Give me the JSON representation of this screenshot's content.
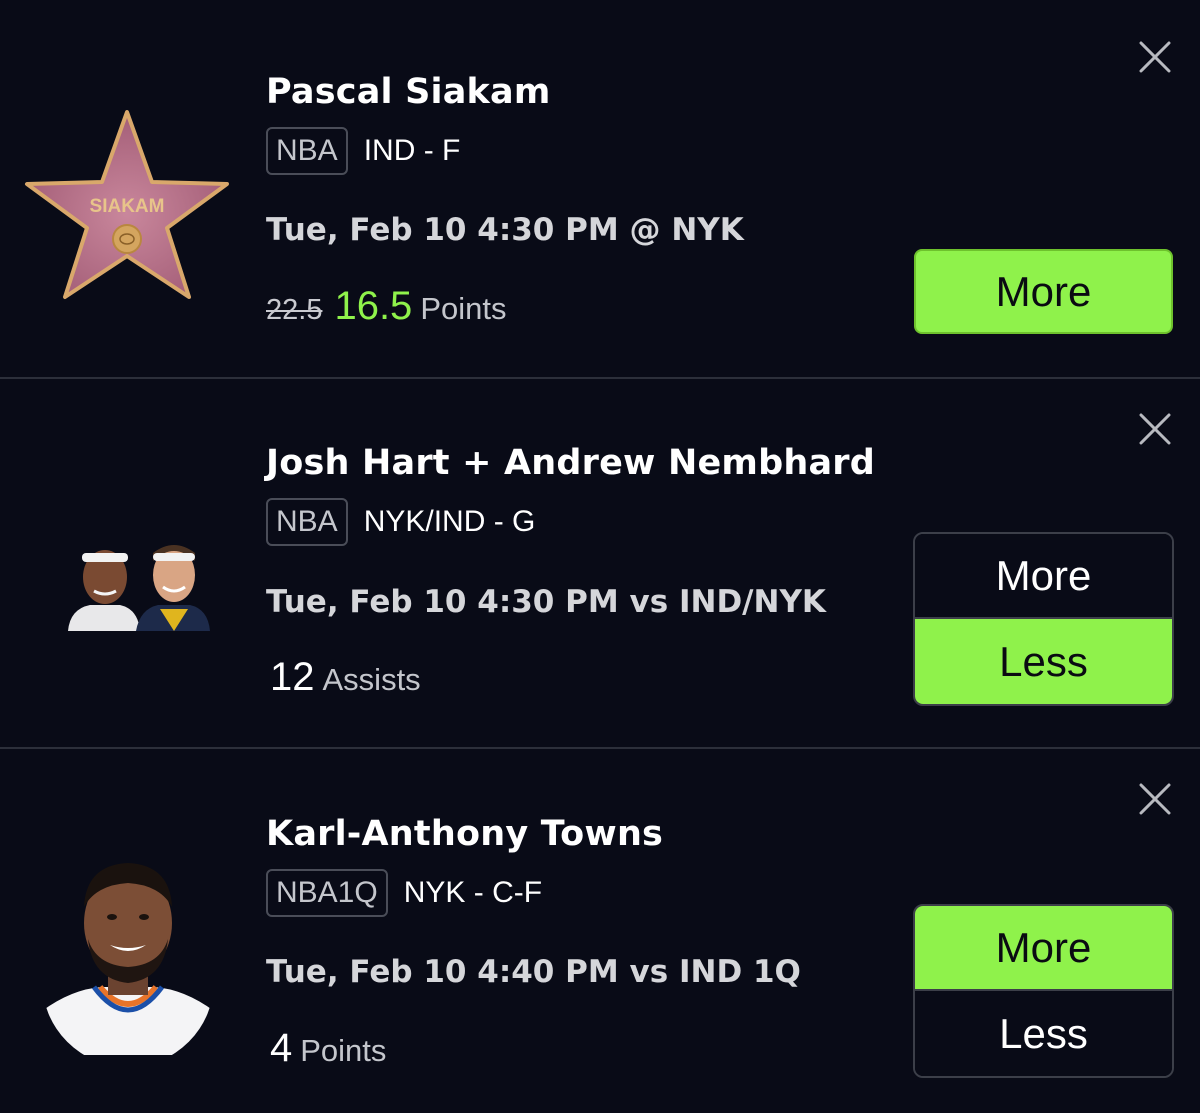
{
  "colors": {
    "background": "#090b17",
    "accent": "#8ff24b",
    "divider": "#2c2f3a"
  },
  "picks": [
    {
      "player": "Pascal Siakam",
      "league": "NBA",
      "team_pos": "IND - F",
      "game": "Tue, Feb 10 4:30 PM @ NYK",
      "old_line": "22.5",
      "line": "16.5",
      "stat": "Points",
      "avatar_text": "SIAKAM",
      "button": "More",
      "selected": "More"
    },
    {
      "player": "Josh Hart + Andrew Nembhard",
      "league": "NBA",
      "team_pos": "NYK/IND - G",
      "game": "Tue, Feb 10 4:30 PM vs IND/NYK",
      "line": "12",
      "stat": "Assists",
      "more": "More",
      "less": "Less",
      "selected": "Less"
    },
    {
      "player": "Karl-Anthony Towns",
      "league": "NBA1Q",
      "team_pos": "NYK - C-F",
      "game": "Tue, Feb 10 4:40 PM vs IND 1Q",
      "line": "4",
      "stat": "Points",
      "more": "More",
      "less": "Less",
      "selected": "More"
    }
  ]
}
